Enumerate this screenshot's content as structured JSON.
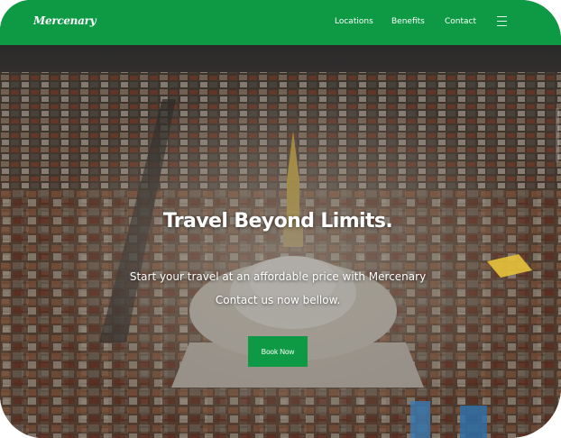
{
  "brand": {
    "name": "Mercenary",
    "accent": "#0e9a44"
  },
  "nav": {
    "links": [
      {
        "label": "Locations"
      },
      {
        "label": "Benefits"
      },
      {
        "label": "Contact"
      }
    ],
    "menu_icon": "hamburger-menu-icon"
  },
  "hero": {
    "title": "Travel Beyond Limits.",
    "subtitle_line1": "Start your travel at an affordable price with Mercenary",
    "subtitle_line2": "Contact us now bellow.",
    "button_label": "Book Now"
  }
}
